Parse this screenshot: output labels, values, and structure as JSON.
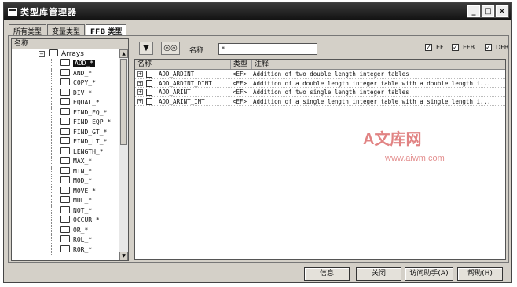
{
  "window": {
    "title": "类型库管理器"
  },
  "tabs": [
    "所有类型",
    "变量类型",
    "FFB 类型"
  ],
  "tree": {
    "header": "名称",
    "root": "Arrays",
    "items": [
      "ADD_*",
      "AND_*",
      "COPY_*",
      "DIV_*",
      "EQUAL_*",
      "FIND_EQ_*",
      "FIND_EQP_*",
      "FIND_GT_*",
      "FIND_LT_*",
      "LENGTH_*",
      "MAX_*",
      "MIN_*",
      "MOD_*",
      "MOVE_*",
      "MUL_*",
      "NOT_*",
      "OCCUR_*",
      "OR_*",
      "ROL_*",
      "ROR_*"
    ],
    "selected_index": 0
  },
  "toolbar": {
    "filter_icon": "filter-icon",
    "name_label": "名称",
    "name_value": "*",
    "checkboxes": [
      {
        "label": "EF",
        "checked": true
      },
      {
        "label": "EFB",
        "checked": true
      },
      {
        "label": "DFB",
        "checked": true
      }
    ]
  },
  "grid": {
    "columns": [
      "名称",
      "类型",
      "注释"
    ],
    "rows": [
      {
        "name": "ADD_ARDINT",
        "type": "<EF>",
        "comment": "Addition of two double length integer tables"
      },
      {
        "name": "ADD_ARDINT_DINT",
        "type": "<EF>",
        "comment": "Addition of a double length integer table with a double length i..."
      },
      {
        "name": "ADD_ARINT",
        "type": "<EF>",
        "comment": "Addition of two single length integer tables"
      },
      {
        "name": "ADD_ARINT_INT",
        "type": "<EF>",
        "comment": "Addition of a single length integer table with a single length i..."
      }
    ]
  },
  "watermark": {
    "line1": "A文库网",
    "line2": "www.aiwm.com"
  },
  "buttons": {
    "info": "信息",
    "close": "关闭",
    "assistant": "访问助手(A)",
    "help": "帮助(H)"
  }
}
